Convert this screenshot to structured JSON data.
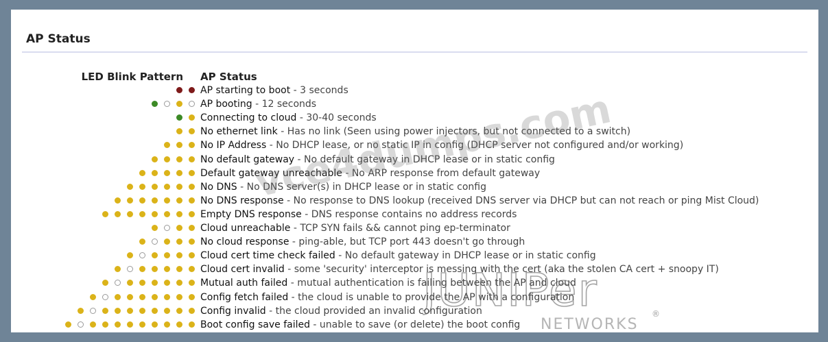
{
  "panel": {
    "title": "AP Status",
    "columns": {
      "led": "LED Blink Pattern",
      "status": "AP Status"
    }
  },
  "colors": {
    "yellow": "#dbb319",
    "red": "#7e1a1a",
    "green": "#3c8a26",
    "off": "#ffffff",
    "frame": "#6f8497"
  },
  "rows": [
    {
      "pattern": "rr",
      "name": "AP starting to boot",
      "desc": " - 3 seconds"
    },
    {
      "pattern": "goyo",
      "name": "AP booting",
      "desc": " - 12 seconds"
    },
    {
      "pattern": "gy",
      "name": "Connecting to cloud",
      "desc": " - 30-40 seconds"
    },
    {
      "pattern": "yy",
      "name": "No ethernet link",
      "desc": " - Has no link (Seen using power injectors, but not connected to a switch)"
    },
    {
      "pattern": "yyy",
      "name": "No IP Address",
      "desc": " - No DHCP lease, or no static IP in config (DHCP server not configured and/or working)"
    },
    {
      "pattern": "yyyy",
      "name": "No default gateway",
      "desc": " - No default gateway in DHCP lease or in static config"
    },
    {
      "pattern": "yyyyy",
      "name": "Default gateway unreachable",
      "desc": " - No ARP response from default gateway"
    },
    {
      "pattern": "yyyyyy",
      "name": "No DNS",
      "desc": " - No DNS server(s) in DHCP lease or in static config"
    },
    {
      "pattern": "yyyyyyy",
      "name": "No DNS response",
      "desc": " - No response to DNS lookup (received DNS server via DHCP but can not reach or ping Mist Cloud)"
    },
    {
      "pattern": "yyyyyyyy",
      "name": "Empty DNS response",
      "desc": " - DNS response contains no address records"
    },
    {
      "pattern": "yoyy",
      "name": "Cloud unreachable",
      "desc": " - TCP SYN fails && cannot ping ep-terminator"
    },
    {
      "pattern": "yoyyy",
      "name": "No cloud response",
      "desc": " - ping-able, but TCP port 443 doesn't go through"
    },
    {
      "pattern": "yoyyyy",
      "name": "Cloud cert time check failed",
      "desc": " - No default gateway in DHCP lease or in static config"
    },
    {
      "pattern": "yoyyyyy",
      "name": "Cloud cert invalid",
      "desc": " - some 'security' interceptor is messing with the cert (aka the stolen CA cert + snoopy IT)"
    },
    {
      "pattern": "yoyyyyyy",
      "name": "Mutual auth failed",
      "desc": " - mutual authentication is failing between the AP and cloud"
    },
    {
      "pattern": "yoyyyyyyy",
      "name": "Config fetch failed",
      "desc": " - the cloud is unable to provide the AP with a configuration"
    },
    {
      "pattern": "yoyyyyyyyy",
      "name": "Config invalid",
      "desc": " - the cloud provided an invalid configuration"
    },
    {
      "pattern": "yoyyyyyyyyy",
      "name": "Boot config save failed",
      "desc": " - unable to save (or delete) the boot config"
    }
  ],
  "watermark": {
    "site": "vce4dumps.com",
    "brand": "JUNIPer",
    "brand_sub": "NETWORKS",
    "reg": "®"
  }
}
